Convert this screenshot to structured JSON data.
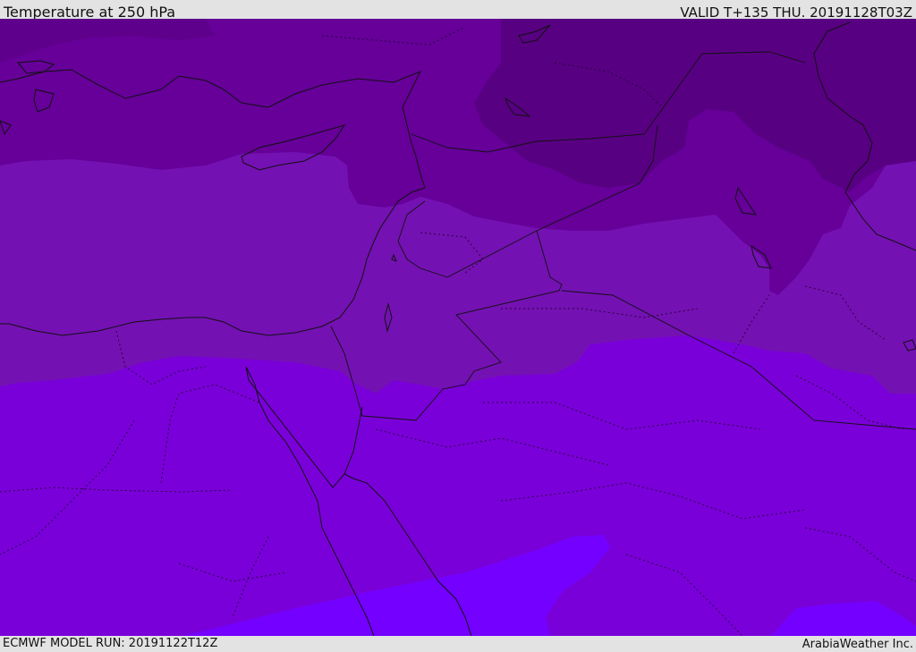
{
  "header": {
    "title": "Temperature at 250 hPa",
    "valid": "VALID T+135 THU. 20191128T03Z"
  },
  "footer": {
    "model_run": "ECMWF MODEL RUN: 20191122T12Z",
    "credit": "ArabiaWeather Inc."
  },
  "colors": {
    "band_darkest": "#580082",
    "band_dark": "#660099",
    "band_mid": "#7411b2",
    "band_violet": "#7a00d9",
    "band_bright": "#7400ff",
    "borders": "#111111"
  }
}
